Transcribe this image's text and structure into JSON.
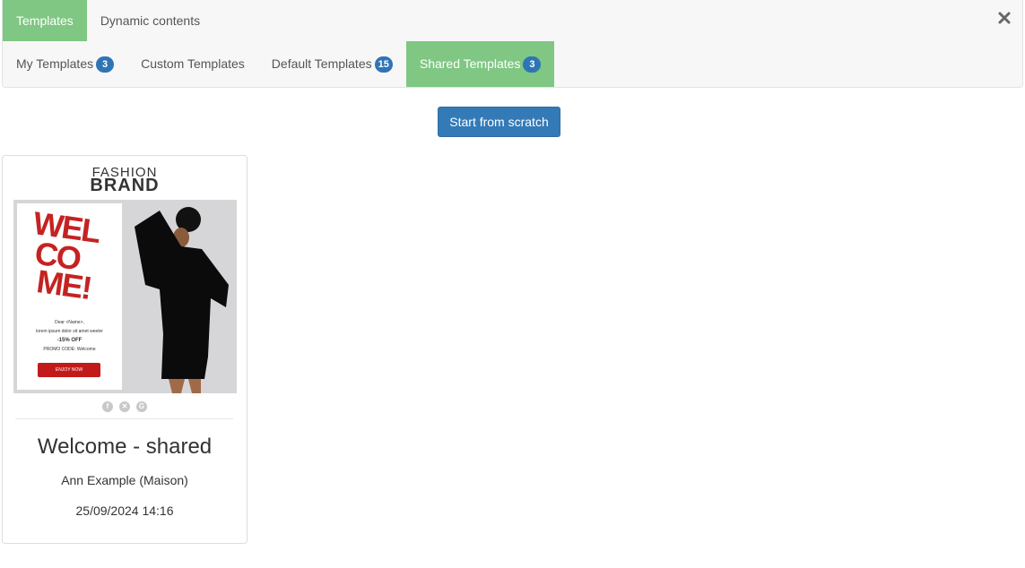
{
  "top_tabs": [
    {
      "label": "Templates",
      "active": true
    },
    {
      "label": "Dynamic contents",
      "active": false
    }
  ],
  "close_icon": "close-icon",
  "sub_tabs": [
    {
      "label": "My Templates",
      "badge": "3",
      "active": false
    },
    {
      "label": "Custom Templates",
      "badge": null,
      "active": false
    },
    {
      "label": "Default Templates",
      "badge": "15",
      "active": false
    },
    {
      "label": "Shared Templates",
      "badge": "3",
      "active": true
    }
  ],
  "actions": {
    "start_from_scratch": "Start from scratch"
  },
  "colors": {
    "active_tab": "#7fc783",
    "badge": "#2f74b5",
    "primary_button": "#337ab7"
  },
  "templates": [
    {
      "title": "Welcome - shared",
      "owner": "Ann Example (Maison)",
      "date": "25/09/2024 14:16",
      "preview": {
        "brand_line1": "FASHION",
        "brand_line2": "BRAND",
        "headline": [
          "WEL",
          "CO",
          "ME!"
        ],
        "greeting": "Dear <Name>,",
        "body": "lorem ipsum dolor sit amet weeler",
        "discount": "-15% OFF",
        "promo": "PROMO CODE: Welcome",
        "cta": "ENJOY NOW",
        "social": [
          "facebook-icon",
          "x-icon",
          "google-plus-icon"
        ]
      }
    }
  ]
}
